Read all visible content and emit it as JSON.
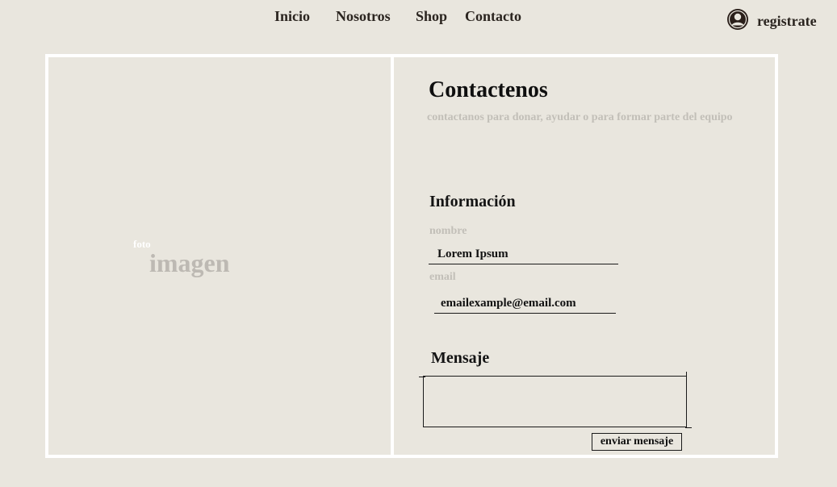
{
  "nav": {
    "items": [
      {
        "label": "Inicio"
      },
      {
        "label": "Nosotros"
      },
      {
        "label": "Shop"
      },
      {
        "label": "Contacto"
      }
    ],
    "register_label": "registrate",
    "register_icon": "user-avatar-icon"
  },
  "image_placeholder": {
    "small_text": "foto",
    "big_text": "imagen"
  },
  "contact": {
    "title": "Contactenos",
    "subtitle": "contactanos para donar, ayudar o para formar parte del equipo",
    "info_heading": "Información",
    "name_label": "nombre",
    "name_value": "Lorem Ipsum",
    "email_label": "email",
    "email_value": "emailexample@email.com",
    "message_heading": "Mensaje",
    "message_value": "",
    "send_label": "enviar mensaje"
  },
  "colors": {
    "background": "#e9e6de",
    "frame": "#ffffff",
    "muted_text": "#c2bfb8",
    "dark_text": "#2b2520"
  }
}
